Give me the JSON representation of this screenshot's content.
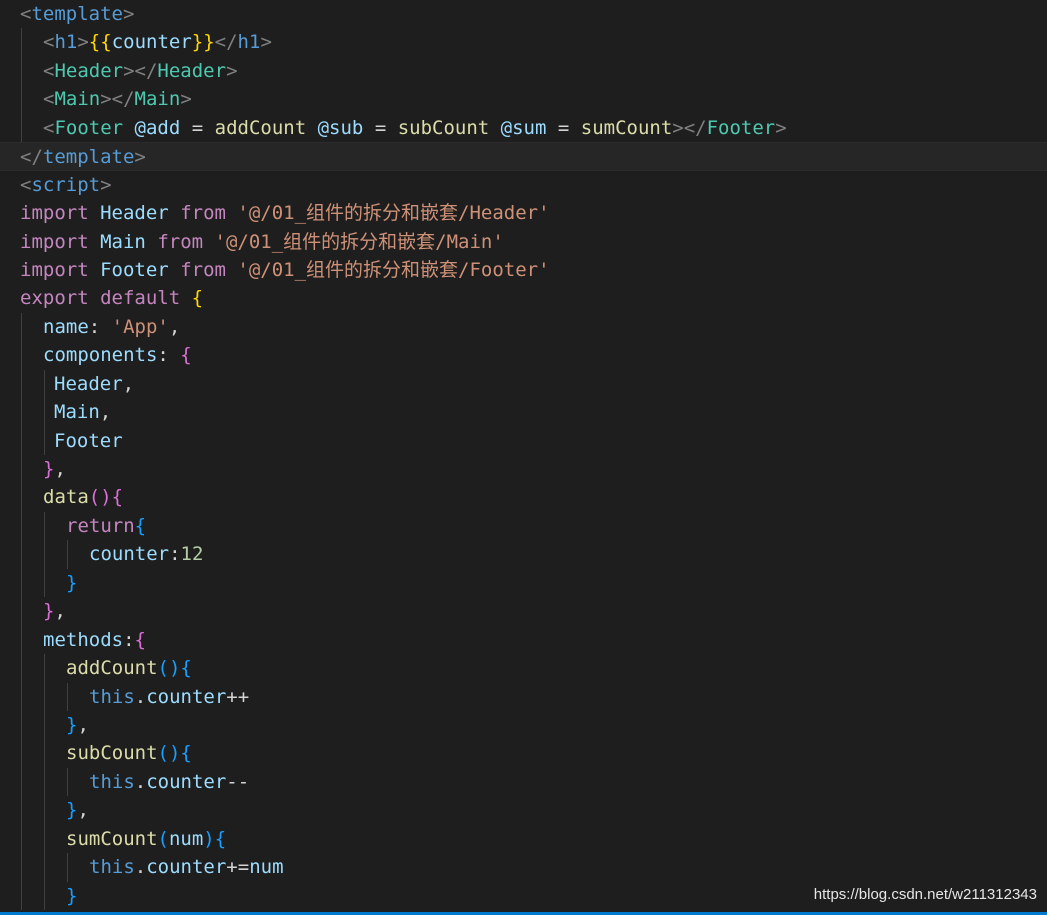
{
  "editor": {
    "lines": [
      {
        "indent": 0,
        "tokens": [
          [
            "tagp",
            "<"
          ],
          [
            "tag",
            "template"
          ],
          [
            "tagp",
            ">"
          ]
        ]
      },
      {
        "indent": 1,
        "tokens": [
          [
            "tagp",
            "<"
          ],
          [
            "tag",
            "h1"
          ],
          [
            "tagp",
            ">"
          ],
          [
            "br1",
            "{{"
          ],
          [
            "prop",
            "counter"
          ],
          [
            "br1",
            "}}"
          ],
          [
            "tagp",
            "</"
          ],
          [
            "tag",
            "h1"
          ],
          [
            "tagp",
            ">"
          ]
        ]
      },
      {
        "indent": 1,
        "tokens": [
          [
            "tagp",
            "<"
          ],
          [
            "comp",
            "Header"
          ],
          [
            "tagp",
            "></"
          ],
          [
            "comp",
            "Header"
          ],
          [
            "tagp",
            ">"
          ]
        ]
      },
      {
        "indent": 1,
        "tokens": [
          [
            "tagp",
            "<"
          ],
          [
            "comp",
            "Main"
          ],
          [
            "tagp",
            "></"
          ],
          [
            "comp",
            "Main"
          ],
          [
            "tagp",
            ">"
          ]
        ]
      },
      {
        "indent": 1,
        "tokens": [
          [
            "tagp",
            "<"
          ],
          [
            "comp",
            "Footer"
          ],
          [
            "plain",
            " "
          ],
          [
            "attr",
            "@add"
          ],
          [
            "plain",
            " = "
          ],
          [
            "fn",
            "addCount"
          ],
          [
            "plain",
            " "
          ],
          [
            "attr",
            "@sub"
          ],
          [
            "plain",
            " = "
          ],
          [
            "fn",
            "subCount"
          ],
          [
            "plain",
            " "
          ],
          [
            "attr",
            "@sum"
          ],
          [
            "plain",
            " = "
          ],
          [
            "fn",
            "sumCount"
          ],
          [
            "tagp",
            "></"
          ],
          [
            "comp",
            "Footer"
          ],
          [
            "tagp",
            ">"
          ]
        ]
      },
      {
        "indent": 0,
        "current": true,
        "tokens": [
          [
            "tagp",
            "</"
          ],
          [
            "tag",
            "template"
          ],
          [
            "tagp",
            ">"
          ]
        ]
      },
      {
        "indent": 0,
        "tokens": [
          [
            "tagp",
            "<"
          ],
          [
            "tag",
            "script"
          ],
          [
            "tagp",
            ">"
          ]
        ]
      },
      {
        "indent": 0,
        "tokens": [
          [
            "kw",
            "import"
          ],
          [
            "plain",
            " "
          ],
          [
            "prop",
            "Header"
          ],
          [
            "plain",
            " "
          ],
          [
            "kw",
            "from"
          ],
          [
            "plain",
            " "
          ],
          [
            "str",
            "'@/01_组件的拆分和嵌套/Header'"
          ]
        ]
      },
      {
        "indent": 0,
        "tokens": [
          [
            "kw",
            "import"
          ],
          [
            "plain",
            " "
          ],
          [
            "prop",
            "Main"
          ],
          [
            "plain",
            " "
          ],
          [
            "kw",
            "from"
          ],
          [
            "plain",
            " "
          ],
          [
            "str",
            "'@/01_组件的拆分和嵌套/Main'"
          ]
        ]
      },
      {
        "indent": 0,
        "tokens": [
          [
            "kw",
            "import"
          ],
          [
            "plain",
            " "
          ],
          [
            "prop",
            "Footer"
          ],
          [
            "plain",
            " "
          ],
          [
            "kw",
            "from"
          ],
          [
            "plain",
            " "
          ],
          [
            "str",
            "'@/01_组件的拆分和嵌套/Footer'"
          ]
        ]
      },
      {
        "indent": 0,
        "tokens": [
          [
            "kw",
            "export"
          ],
          [
            "plain",
            " "
          ],
          [
            "kw",
            "default"
          ],
          [
            "plain",
            " "
          ],
          [
            "br1",
            "{"
          ]
        ]
      },
      {
        "indent": 1,
        "tokens": [
          [
            "prop",
            "name"
          ],
          [
            "plain",
            ": "
          ],
          [
            "str",
            "'App'"
          ],
          [
            "plain",
            ","
          ]
        ]
      },
      {
        "indent": 1,
        "tokens": [
          [
            "prop",
            "components"
          ],
          [
            "plain",
            ": "
          ],
          [
            "br2",
            "{"
          ]
        ]
      },
      {
        "indent": 1,
        "extra": 11,
        "tokens": [
          [
            "prop",
            "Header"
          ],
          [
            "plain",
            ","
          ]
        ]
      },
      {
        "indent": 1,
        "extra": 11,
        "tokens": [
          [
            "prop",
            "Main"
          ],
          [
            "plain",
            ","
          ]
        ]
      },
      {
        "indent": 1,
        "extra": 11,
        "tokens": [
          [
            "prop",
            "Footer"
          ]
        ]
      },
      {
        "indent": 1,
        "tokens": [
          [
            "br2",
            "}"
          ],
          [
            "plain",
            ","
          ]
        ]
      },
      {
        "indent": 1,
        "tokens": [
          [
            "fn",
            "data"
          ],
          [
            "br2",
            "()"
          ],
          [
            "br2",
            "{"
          ]
        ]
      },
      {
        "indent": 2,
        "tokens": [
          [
            "kw",
            "return"
          ],
          [
            "br3",
            "{"
          ]
        ]
      },
      {
        "indent": 3,
        "tokens": [
          [
            "prop",
            "counter"
          ],
          [
            "plain",
            ":"
          ],
          [
            "num",
            "12"
          ]
        ]
      },
      {
        "indent": 2,
        "tokens": [
          [
            "br3",
            "}"
          ]
        ]
      },
      {
        "indent": 1,
        "tokens": [
          [
            "br2",
            "}"
          ],
          [
            "plain",
            ","
          ]
        ]
      },
      {
        "indent": 1,
        "tokens": [
          [
            "prop",
            "methods"
          ],
          [
            "plain",
            ":"
          ],
          [
            "br2",
            "{"
          ]
        ]
      },
      {
        "indent": 2,
        "tokens": [
          [
            "fn",
            "addCount"
          ],
          [
            "br3",
            "()"
          ],
          [
            "br3",
            "{"
          ]
        ]
      },
      {
        "indent": 3,
        "tokens": [
          [
            "kwb",
            "this"
          ],
          [
            "plain",
            "."
          ],
          [
            "prop",
            "counter"
          ],
          [
            "plain",
            "++"
          ]
        ]
      },
      {
        "indent": 2,
        "tokens": [
          [
            "br3",
            "}"
          ],
          [
            "plain",
            ","
          ]
        ]
      },
      {
        "indent": 2,
        "tokens": [
          [
            "fn",
            "subCount"
          ],
          [
            "br3",
            "()"
          ],
          [
            "br3",
            "{"
          ]
        ]
      },
      {
        "indent": 3,
        "tokens": [
          [
            "kwb",
            "this"
          ],
          [
            "plain",
            "."
          ],
          [
            "prop",
            "counter"
          ],
          [
            "plain",
            "--"
          ]
        ]
      },
      {
        "indent": 2,
        "tokens": [
          [
            "br3",
            "}"
          ],
          [
            "plain",
            ","
          ]
        ]
      },
      {
        "indent": 2,
        "tokens": [
          [
            "fn",
            "sumCount"
          ],
          [
            "br3",
            "("
          ],
          [
            "prop",
            "num"
          ],
          [
            "br3",
            ")"
          ],
          [
            "br3",
            "{"
          ]
        ]
      },
      {
        "indent": 3,
        "tokens": [
          [
            "kwb",
            "this"
          ],
          [
            "plain",
            "."
          ],
          [
            "prop",
            "counter"
          ],
          [
            "plain",
            "+="
          ],
          [
            "prop",
            "num"
          ]
        ]
      },
      {
        "indent": 2,
        "tokens": [
          [
            "br3",
            "}"
          ]
        ]
      }
    ]
  },
  "watermark": "https://blog.csdn.net/w211312343",
  "colors": {
    "background": "#1e1e1e",
    "tag": "#569cd6",
    "component": "#4ec9b0",
    "string": "#ce9178",
    "keyword": "#c586c0",
    "function": "#dcdcaa",
    "property": "#9cdcfe",
    "number": "#b5cea8",
    "accent": "#007acc"
  }
}
